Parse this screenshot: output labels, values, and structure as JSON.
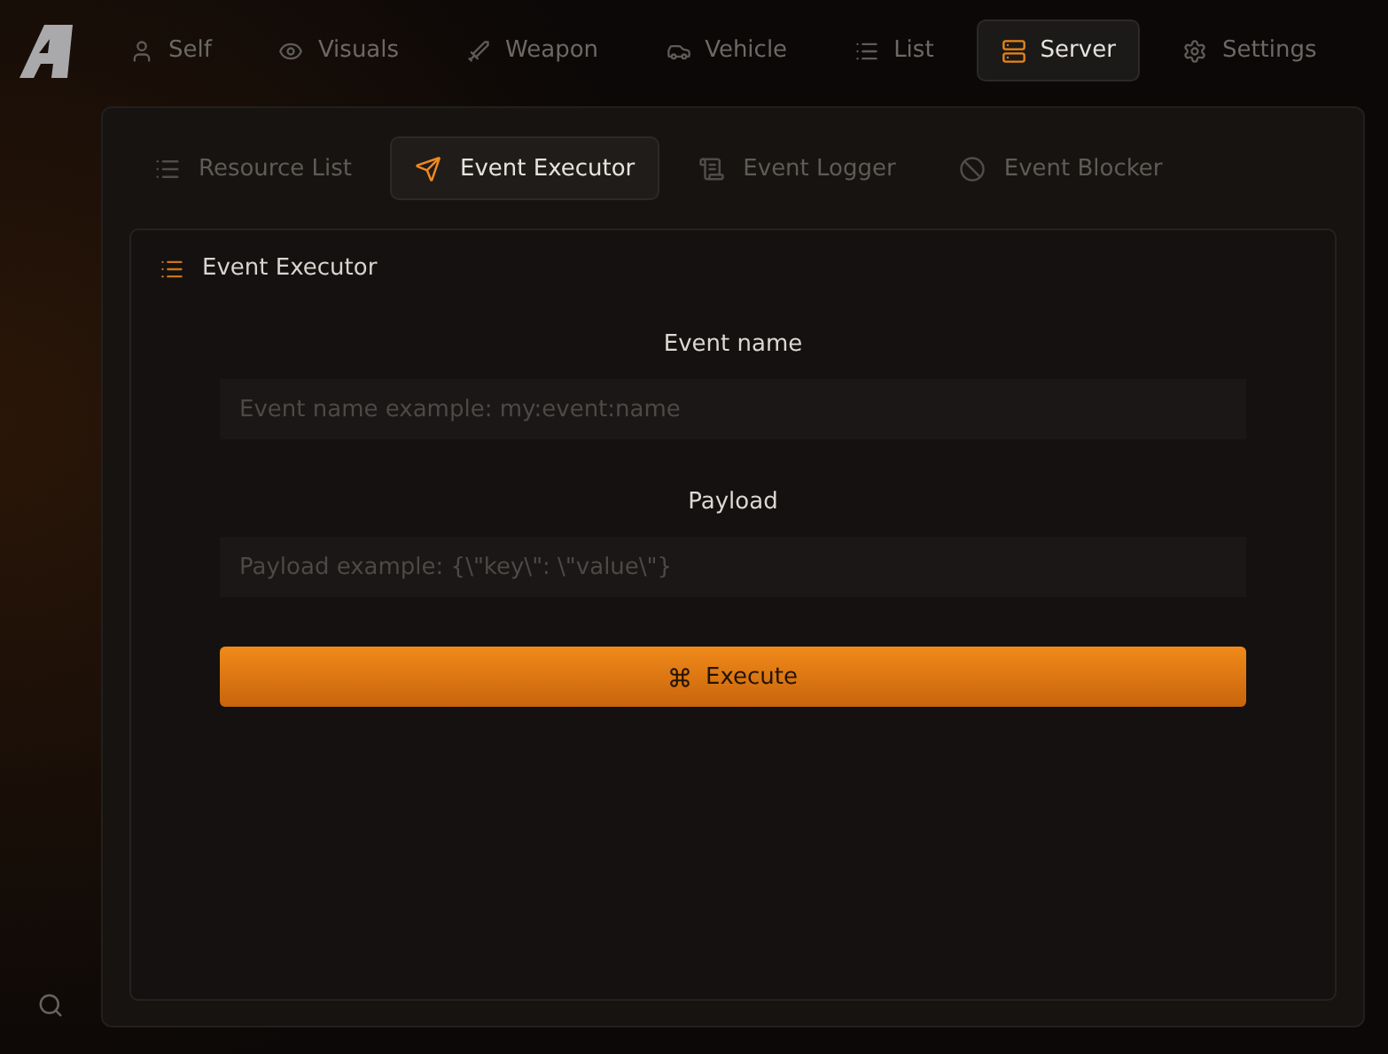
{
  "nav_tabs": [
    {
      "label": "Self",
      "selected": false
    },
    {
      "label": "Visuals",
      "selected": false
    },
    {
      "label": "Weapon",
      "selected": false
    },
    {
      "label": "Vehicle",
      "selected": false
    },
    {
      "label": "List",
      "selected": false
    },
    {
      "label": "Server",
      "selected": true
    },
    {
      "label": "Settings",
      "selected": false
    }
  ],
  "sub_tabs": [
    {
      "label": "Resource List",
      "selected": false
    },
    {
      "label": "Event Executor",
      "selected": true
    },
    {
      "label": "Event Logger",
      "selected": false
    },
    {
      "label": "Event Blocker",
      "selected": false
    }
  ],
  "card": {
    "title": "Event Executor",
    "fields": [
      {
        "label": "Event name",
        "placeholder": "Event name example: my:event:name"
      },
      {
        "label": "Payload",
        "placeholder": "Payload example: {\\\"key\\\": \\\"value\\\"}"
      }
    ],
    "button": "Execute"
  }
}
